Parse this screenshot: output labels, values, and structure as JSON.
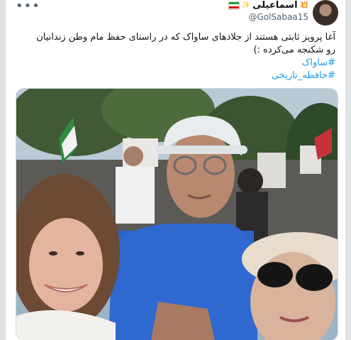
{
  "header": {
    "display_name": "اسماعیلی",
    "emoji_left": "✨",
    "emoji_right": "💥",
    "handle": "@GolSabaa15",
    "more_icon": "more-horizontal-icon"
  },
  "tweet": {
    "text_line1": "آغا پرویز ثابتی هستند از جلادهای ساواک که در راستای حفظ مام وطن زندانیان",
    "text_line2": "رو شکنجه می‌کرده :)",
    "hashtags": [
      "#ساواک",
      "#حافظه_تاریخی"
    ]
  },
  "colors": {
    "hashtag": "#1d9bf0",
    "text": "#0f1419",
    "muted": "#536471"
  },
  "photo": {
    "description_icon": "selfie-photo-icon"
  }
}
